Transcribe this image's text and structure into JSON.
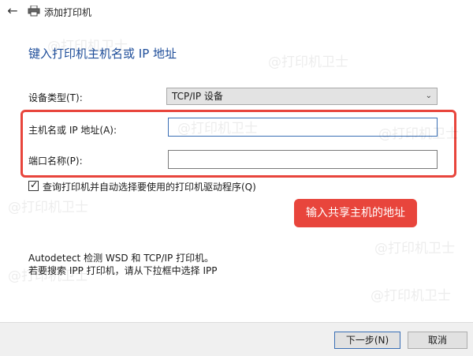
{
  "window": {
    "title": "添加打印机"
  },
  "heading": "键入打印机主机名或 IP 地址",
  "form": {
    "device_type_label": "设备类型(T):",
    "device_type_value": "TCP/IP 设备",
    "host_label": "主机名或 IP 地址(A):",
    "host_value": "",
    "port_label": "端口名称(P):",
    "port_value": "",
    "query_checkbox_label": "查询打印机并自动选择要使用的打印机驱动程序(Q)",
    "query_checked": true
  },
  "callout": "输入共享主机的地址",
  "info": {
    "line1": "Autodetect 检测 WSD 和 TCP/IP 打印机。",
    "line2": "若要搜索 IPP 打印机，请从下拉框中选择 IPP"
  },
  "buttons": {
    "next": "下一步(N)",
    "cancel": "取消"
  },
  "watermark": "@打印机卫士",
  "colors": {
    "heading": "#1f4e9a",
    "highlight": "#e8453c",
    "callout_bg": "#e8453c"
  },
  "icons": {
    "back": "back-arrow-icon",
    "printer": "printer-icon",
    "dropdown": "chevron-down-icon",
    "check": "checkmark-icon"
  }
}
